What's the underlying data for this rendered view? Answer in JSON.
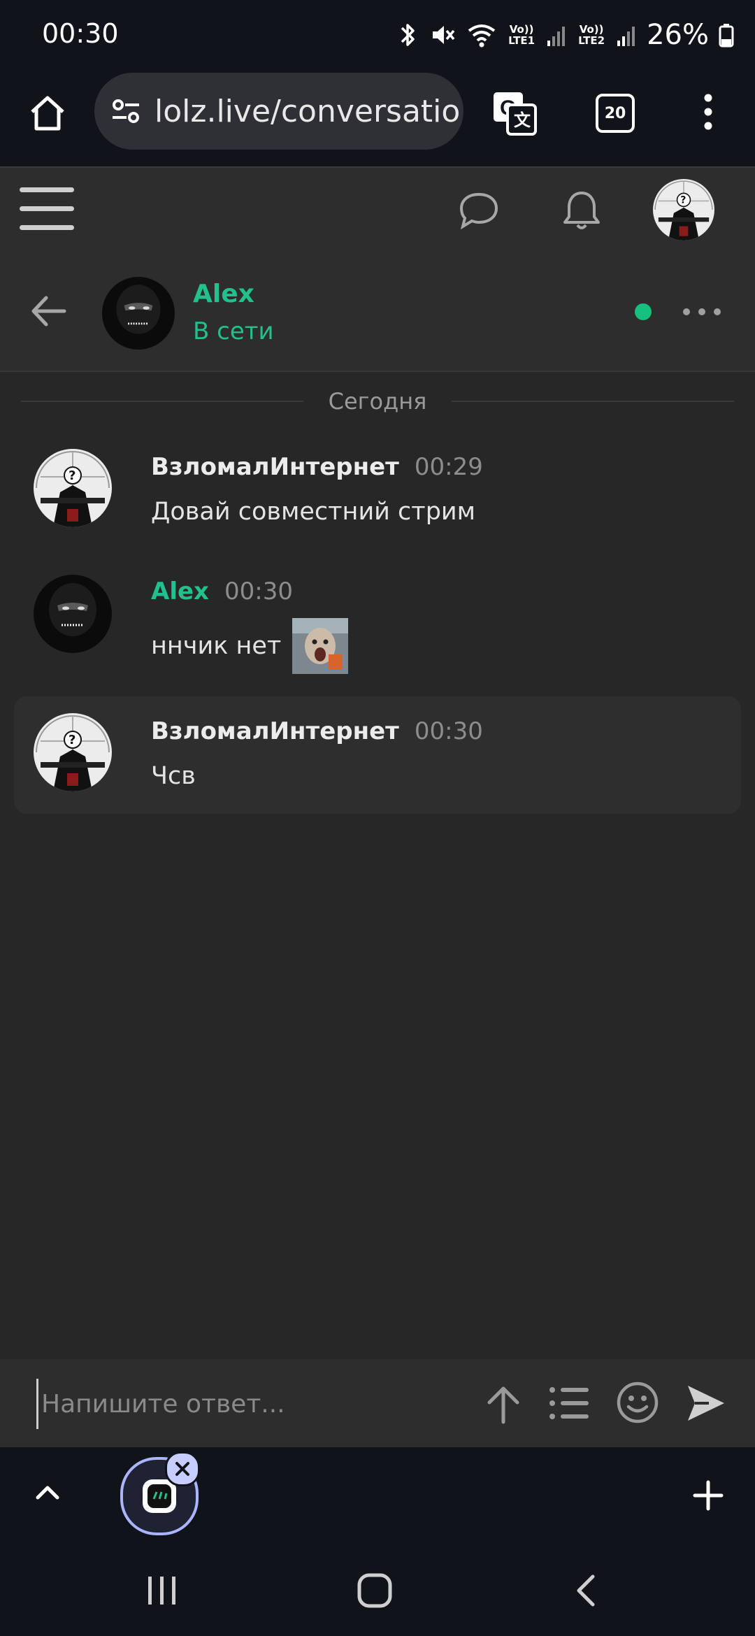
{
  "status_bar": {
    "time": "00:30",
    "sim1_label": "Vo)) LTE1",
    "sim2_label": "Vo)) LTE2",
    "battery": "26%"
  },
  "browser": {
    "url": "lolz.live/conversatio",
    "tab_count": "20"
  },
  "conversation": {
    "contact_name": "Alex",
    "contact_status": "В сети",
    "date_separator": "Сегодня"
  },
  "messages": [
    {
      "author": "ВзломалИнтернет",
      "time": "00:29",
      "text": "Довай совместний стрим"
    },
    {
      "author": "Alex",
      "time": "00:30",
      "text": "ннчик нет"
    },
    {
      "author": "ВзломалИнтернет",
      "time": "00:30",
      "text": "Чсв"
    }
  ],
  "composer": {
    "placeholder": "Напишите ответ..."
  },
  "colors": {
    "accent_green": "#22c08f",
    "online_dot": "#18c07e",
    "background": "#272727",
    "system_bar": "#11131a"
  }
}
